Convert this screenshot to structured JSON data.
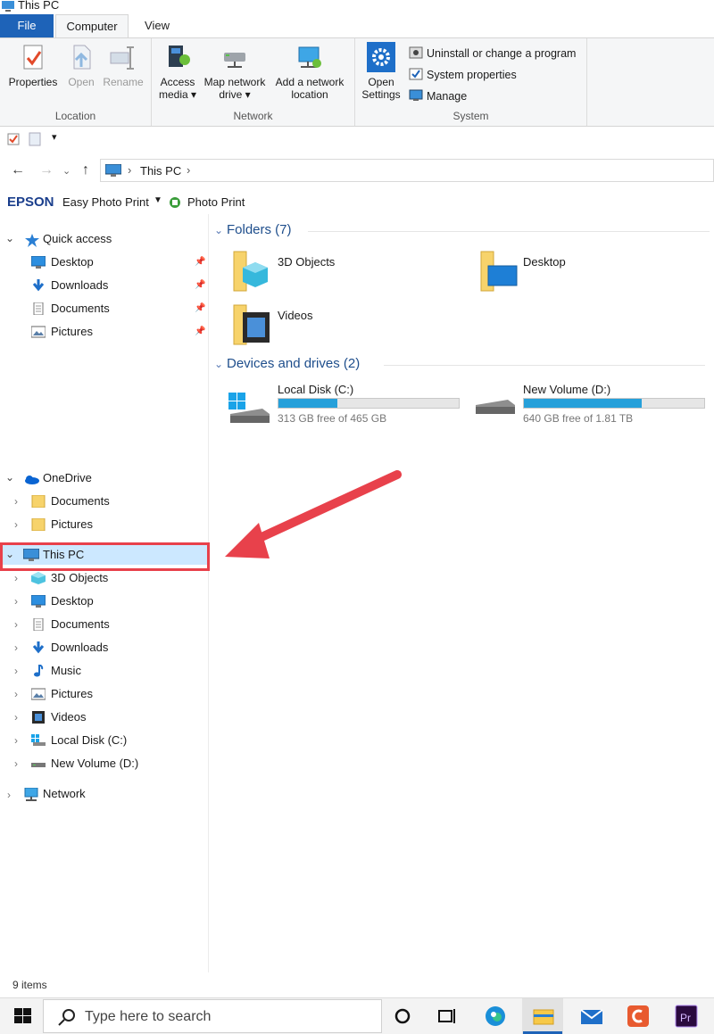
{
  "window": {
    "title": "This PC"
  },
  "tabs": [
    {
      "label": "File"
    },
    {
      "label": "Computer"
    },
    {
      "label": "View"
    }
  ],
  "ribbon": {
    "location": {
      "label": "Location",
      "buttons": [
        {
          "label": "Properties"
        },
        {
          "label": "Open"
        },
        {
          "label": "Rename"
        }
      ]
    },
    "network": {
      "label": "Network",
      "buttons": [
        {
          "line1": "Access",
          "line2": "media ▾"
        },
        {
          "line1": "Map network",
          "line2": "drive ▾"
        },
        {
          "line1": "Add a network",
          "line2": "location"
        }
      ]
    },
    "system": {
      "label": "System",
      "open_settings": {
        "line1": "Open",
        "line2": "Settings"
      },
      "items": [
        {
          "label": "Uninstall or change a program"
        },
        {
          "label": "System properties"
        },
        {
          "label": "Manage"
        }
      ]
    }
  },
  "address": {
    "path": "This PC",
    "back": "←",
    "forward": "→",
    "up": "↑",
    "sep": "›"
  },
  "epson": {
    "brand": "EPSON",
    "easy": "Easy Photo Print",
    "photo": "Photo Print"
  },
  "nav": {
    "quick_access": {
      "label": "Quick access",
      "items": [
        {
          "label": "Desktop"
        },
        {
          "label": "Downloads"
        },
        {
          "label": "Documents"
        },
        {
          "label": "Pictures"
        }
      ]
    },
    "onedrive": {
      "label": "OneDrive",
      "items": [
        {
          "label": "Documents"
        },
        {
          "label": "Pictures"
        }
      ]
    },
    "this_pc": {
      "label": "This PC",
      "items": [
        {
          "label": "3D Objects"
        },
        {
          "label": "Desktop"
        },
        {
          "label": "Documents"
        },
        {
          "label": "Downloads"
        },
        {
          "label": "Music"
        },
        {
          "label": "Pictures"
        },
        {
          "label": "Videos"
        },
        {
          "label": "Local Disk (C:)"
        },
        {
          "label": "New Volume (D:)"
        }
      ]
    },
    "network": {
      "label": "Network"
    }
  },
  "content": {
    "folders_header": "Folders (7)",
    "folders": [
      {
        "label": "3D Objects"
      },
      {
        "label": "Desktop"
      },
      {
        "label": "Videos"
      }
    ],
    "drives_header": "Devices and drives (2)",
    "drives": [
      {
        "label": "Local Disk (C:)",
        "free": "313 GB free of 465 GB",
        "used_fraction": 0.327
      },
      {
        "label": "New Volume (D:)",
        "free": "640 GB free of 1.81 TB",
        "used_fraction": 0.655
      }
    ]
  },
  "status": {
    "items": "9 items"
  },
  "taskbar": {
    "search_placeholder": "Type here to search"
  },
  "colors": {
    "accent": "#1e63b8",
    "highlight": "#cce8ff",
    "annotation": "#e8414b",
    "bar_fill": "#26a0da"
  }
}
